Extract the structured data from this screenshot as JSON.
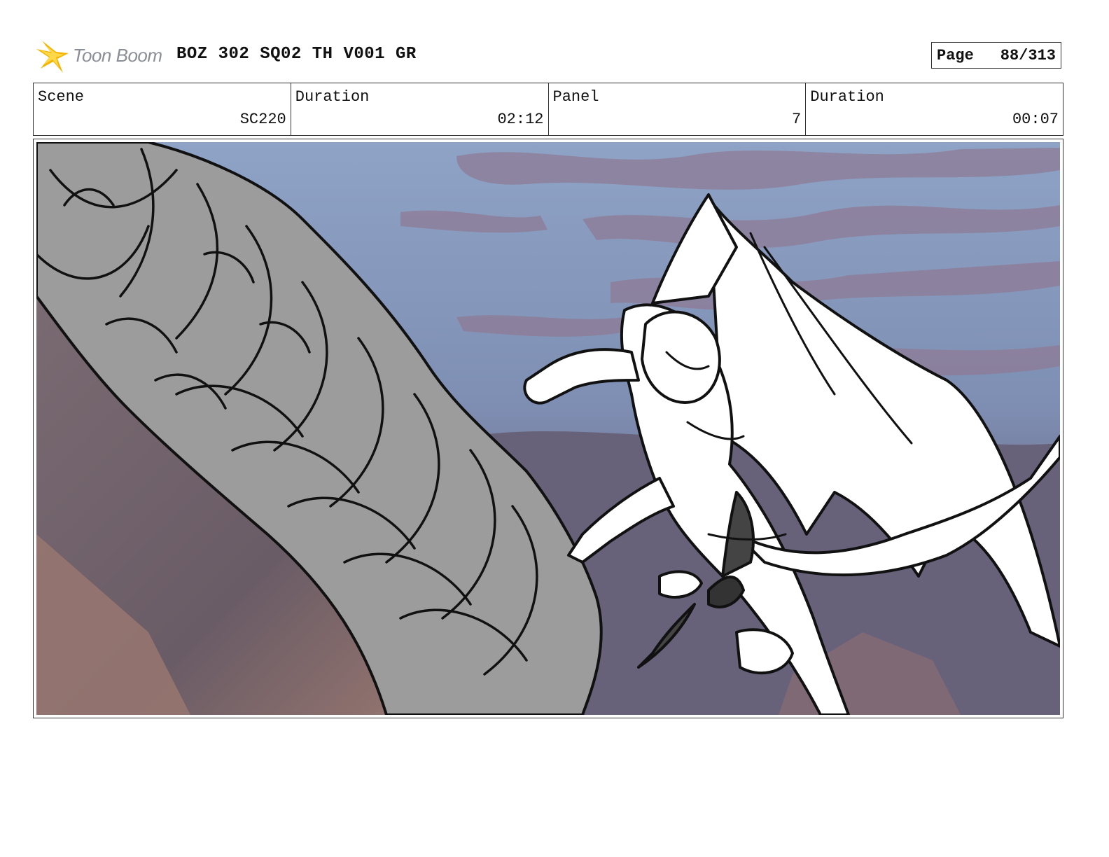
{
  "header": {
    "logo_text": "Toon Boom",
    "title": "BOZ 302 SQ02 TH V001 GR",
    "page_label": "Page",
    "page_value": "88/313"
  },
  "info": [
    {
      "label": "Scene",
      "value": "SC220"
    },
    {
      "label": "Duration",
      "value": "02:12"
    },
    {
      "label": "Panel",
      "value": "7"
    },
    {
      "label": "Duration",
      "value": "00:07"
    }
  ],
  "colors": {
    "logo_star": "#f5b400",
    "logo_text": "#8a8f96",
    "sky": "#8fa3c4",
    "cloud": "#8e7b96",
    "rock_shadow": "#6a5c66",
    "rock_warm": "#9b7870",
    "creature_fill": "#9c9c9c",
    "figure_fill": "#ffffff",
    "line": "#111111"
  },
  "panel": {
    "image_description": "Storyboard sketch: winged gargoyle figure fighting a large grey tentacled creature against a purple cloudy sky"
  }
}
